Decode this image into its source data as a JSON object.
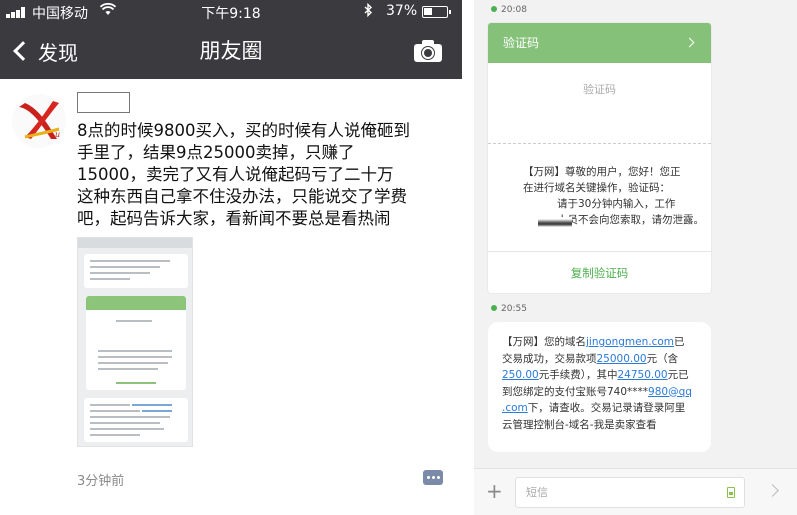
{
  "left": {
    "status_bar": {
      "carrier": "中国移动",
      "time": "下午9:18",
      "battery": "37%",
      "battery_level": 0.37
    },
    "nav": {
      "back_label": "发现",
      "title": "朋友圈"
    },
    "post": {
      "lines": [
        "8点的时候9800买入，买的时候有人说俺砸到",
        "手里了，结果9点25000卖掉，只赚了",
        "15000，卖完了又有人说俺起码亏了二十万",
        "这种东西自己拿不住没办法，只能说交了学费",
        "吧，起码告诉大家，看新闻不要总是看热闹"
      ],
      "time_ago": "3分钟前"
    }
  },
  "right": {
    "timestamp1": "20:08",
    "card": {
      "header": "验证码",
      "subtitle": "验证码",
      "body": [
        "【万网】尊敬的用户，您好！您正",
        "在进行域名关键操作，验证码：",
        "请于30分钟内输入，工作",
        "人员不会向您索取，请勿泄露。"
      ],
      "copy_button": "复制验证码"
    },
    "timestamp2": "20:55",
    "message": {
      "l1_a": "【万网】您的域名",
      "domain_link": "jingongmen.com",
      "l1_b": "已",
      "l2_a": "交易成功，交易款项",
      "amount_link": "25000.00",
      "l2_b": "元（含",
      "fee_link": "250.00",
      "l3_b": "元手续费），其中",
      "net_link": "24750.00",
      "l3_c": "元已",
      "l4_a": "到您绑定的支付宝账号740****",
      "account_link_a": "980@qq",
      "account_link_b": ".com",
      "l5_b": "下，请查收。交易记录请登录阿里",
      "l6": "云管理控制台-域名-我是卖家查看"
    },
    "input_placeholder": "短信"
  },
  "colors": {
    "nav_bg": "#3a3a3f",
    "card_header": "#86c17a",
    "link": "#2a7ad9",
    "copy_button": "#4cae4c"
  },
  "icons": [
    "signal-icon",
    "wifi-icon",
    "bluetooth-icon",
    "battery-icon",
    "back-chevron-icon",
    "camera-icon",
    "comment-icon",
    "chevron-right-icon",
    "plus-icon",
    "sim-icon",
    "send-icon"
  ]
}
